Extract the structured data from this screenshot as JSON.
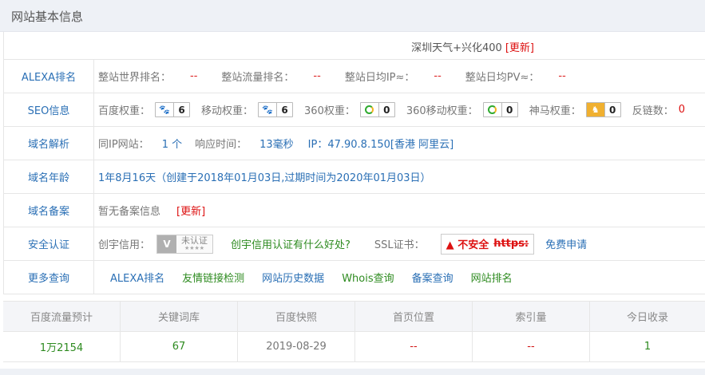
{
  "panel": {
    "title": "网站基本信息"
  },
  "weather": {
    "text": "深圳天气+兴化400",
    "update": "[更新]"
  },
  "rows": {
    "alexa": {
      "label": "ALEXA排名",
      "world_rank_key": "整站世界排名：",
      "world_rank_val": "--",
      "traffic_rank_key": "整站流量排名：",
      "traffic_rank_val": "--",
      "daily_ip_key": "整站日均IP≈：",
      "daily_ip_val": "--",
      "daily_pv_key": "整站日均PV≈：",
      "daily_pv_val": "--"
    },
    "seo": {
      "label": "SEO信息",
      "baidu_key": "百度权重：",
      "baidu_val": "6",
      "mobile_key": "移动权重：",
      "mobile_val": "6",
      "s360_key": "360权重：",
      "s360_val": "0",
      "s360m_key": "360移动权重：",
      "s360m_val": "0",
      "shenma_key": "神马权重：",
      "shenma_val": "0",
      "backlink_key": "反链数：",
      "backlink_val": "0"
    },
    "dns": {
      "label": "域名解析",
      "same_ip_key": "同IP网站：",
      "same_ip_val": "1 个",
      "resp_key": "响应时间：",
      "resp_val": "13毫秒",
      "ip_text": "IP：47.90.8.150[香港 阿里云]"
    },
    "age": {
      "label": "域名年龄",
      "text": "1年8月16天（创建于2018年01月03日,过期时间为2020年01月03日）"
    },
    "icp": {
      "label": "域名备案",
      "text": "暂无备案信息",
      "update": "[更新]"
    },
    "security": {
      "label": "安全认证",
      "credit_key": "创宇信用：",
      "badge_v": "V",
      "badge_text": "未认证",
      "badge_stars": "★★★★",
      "credit_link": "创宇信用认证有什么好处?",
      "ssl_key": "SSL证书：",
      "ssl_warn": "▲ 不安全",
      "ssl_https": "https:",
      "ssl_apply": "免费申请"
    },
    "more": {
      "label": "更多查询",
      "links": [
        "ALEXA排名",
        "友情链接检测",
        "网站历史数据",
        "Whois查询",
        "备案查询",
        "网站排名"
      ]
    }
  },
  "stats": {
    "headers": [
      "百度流量预计",
      "关键词库",
      "百度快照",
      "首页位置",
      "索引量",
      "今日收录"
    ],
    "values": [
      "1万2154",
      "67",
      "2019-08-29",
      "--",
      "--",
      "1"
    ],
    "colors": [
      "#2e8b20",
      "#2e8b20",
      "#777777",
      "#d11111",
      "#d11111",
      "#2e8b20"
    ]
  }
}
